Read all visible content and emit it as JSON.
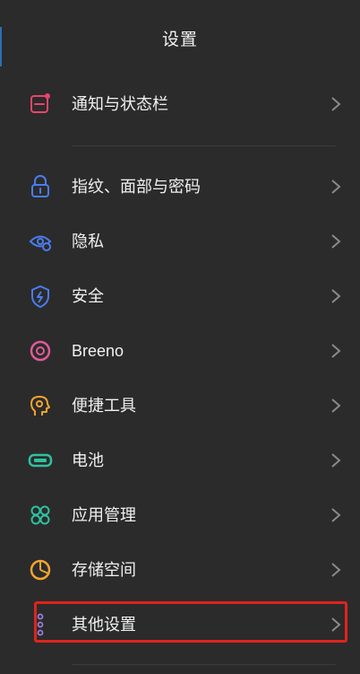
{
  "header": {
    "title": "设置"
  },
  "items": [
    {
      "label": "通知与状态栏",
      "icon": "notification-icon"
    },
    {
      "label": "指纹、面部与密码",
      "icon": "lock-icon"
    },
    {
      "label": "隐私",
      "icon": "privacy-eye-icon"
    },
    {
      "label": "安全",
      "icon": "security-shield-icon"
    },
    {
      "label": "Breeno",
      "icon": "breeno-ring-icon"
    },
    {
      "label": "便捷工具",
      "icon": "convenience-tools-icon"
    },
    {
      "label": "电池",
      "icon": "battery-icon"
    },
    {
      "label": "应用管理",
      "icon": "app-management-icon"
    },
    {
      "label": "存储空间",
      "icon": "storage-pie-icon"
    },
    {
      "label": "其他设置",
      "icon": "more-settings-icon"
    }
  ],
  "colors": {
    "background": "#2b2b2b",
    "highlight": "#e0231d",
    "chevron": "#8a8a8a"
  }
}
